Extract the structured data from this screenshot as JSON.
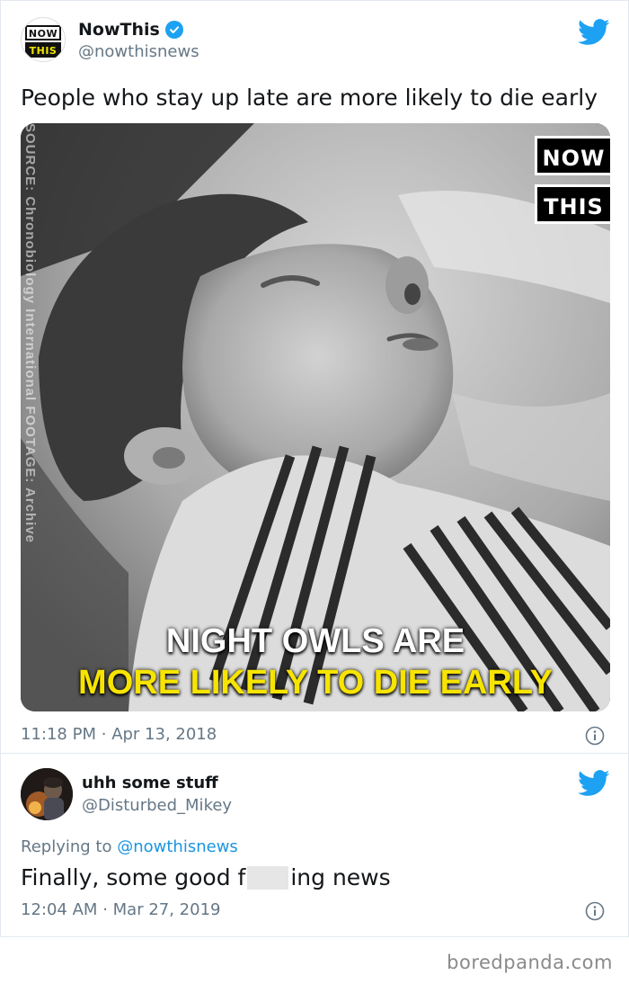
{
  "tweet_main": {
    "avatar_text_top": "NOW",
    "avatar_text_bottom": "THIS",
    "display_name": "NowThis",
    "handle": "@nowthisnews",
    "verified": true,
    "text": "People who stay up late are more likely to die early",
    "media": {
      "logo_top": "NOW",
      "logo_bottom": "THIS",
      "caption_line1": "NIGHT OWLS ARE",
      "caption_line2": "MORE LIKELY TO DIE EARLY",
      "source_credit": "SOURCE: Chronobiology International   FOOTAGE: Archive",
      "caption_colors": {
        "line1": "#ffffff",
        "line2": "#f7e400"
      }
    },
    "time": "11:18 PM",
    "separator": "·",
    "date": "Apr 13, 2018"
  },
  "tweet_reply": {
    "display_name": "uhh some stuff",
    "handle": "@Disturbed_Mikey",
    "replying_prefix": "Replying to",
    "replying_mention": "@nowthisnews",
    "text_before_censor": "Finally, some good f",
    "text_after_censor": "ing news",
    "time": "12:04 AM",
    "separator": "·",
    "date": "Mar 27, 2019"
  },
  "watermark": "boredpanda.com",
  "colors": {
    "twitter_blue": "#1da1f2",
    "mention_blue": "#1b95e0",
    "meta_gray": "#657786",
    "border": "#e1e8ed"
  },
  "icons": {
    "bird": "twitter-bird-icon",
    "verified": "verified-badge-icon",
    "info": "info-icon"
  }
}
